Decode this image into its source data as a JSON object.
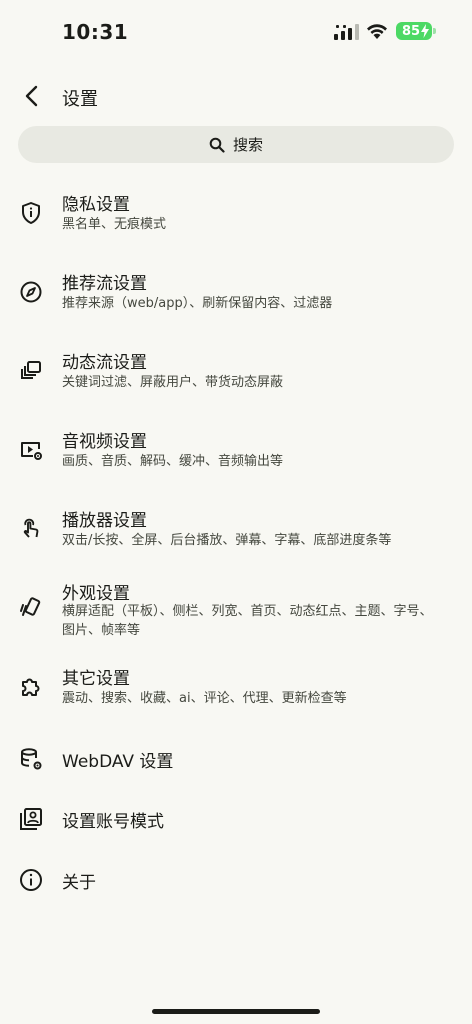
{
  "status_bar": {
    "time": "10:31",
    "battery": "85"
  },
  "header": {
    "title": "设置"
  },
  "search": {
    "label": "搜索"
  },
  "items": [
    {
      "title": "隐私设置",
      "subtitle": "黑名单、无痕模式",
      "icon": "shield-icon"
    },
    {
      "title": "推荐流设置",
      "subtitle": "推荐来源（web/app）、刷新保留内容、过滤器",
      "icon": "compass-icon"
    },
    {
      "title": "动态流设置",
      "subtitle": "关键词过滤、屏蔽用户、带货动态屏蔽",
      "icon": "stack-icon"
    },
    {
      "title": "音视频设置",
      "subtitle": "画质、音质、解码、缓冲、音频输出等",
      "icon": "video-settings-icon"
    },
    {
      "title": "播放器设置",
      "subtitle": "双击/长按、全屏、后台播放、弹幕、字幕、底部进度条等",
      "icon": "touch-icon"
    },
    {
      "title": "外观设置",
      "subtitle": "横屏适配（平板）、侧栏、列宽、首页、动态红点、主题、字号、图片、帧率等",
      "icon": "brush-icon"
    },
    {
      "title": "其它设置",
      "subtitle": "震动、搜索、收藏、ai、评论、代理、更新检查等",
      "icon": "extension-icon"
    },
    {
      "title": "WebDAV 设置",
      "subtitle": "",
      "icon": "database-settings-icon"
    },
    {
      "title": "设置账号模式",
      "subtitle": "",
      "icon": "account-box-icon"
    },
    {
      "title": "关于",
      "subtitle": "",
      "icon": "info-icon"
    }
  ]
}
